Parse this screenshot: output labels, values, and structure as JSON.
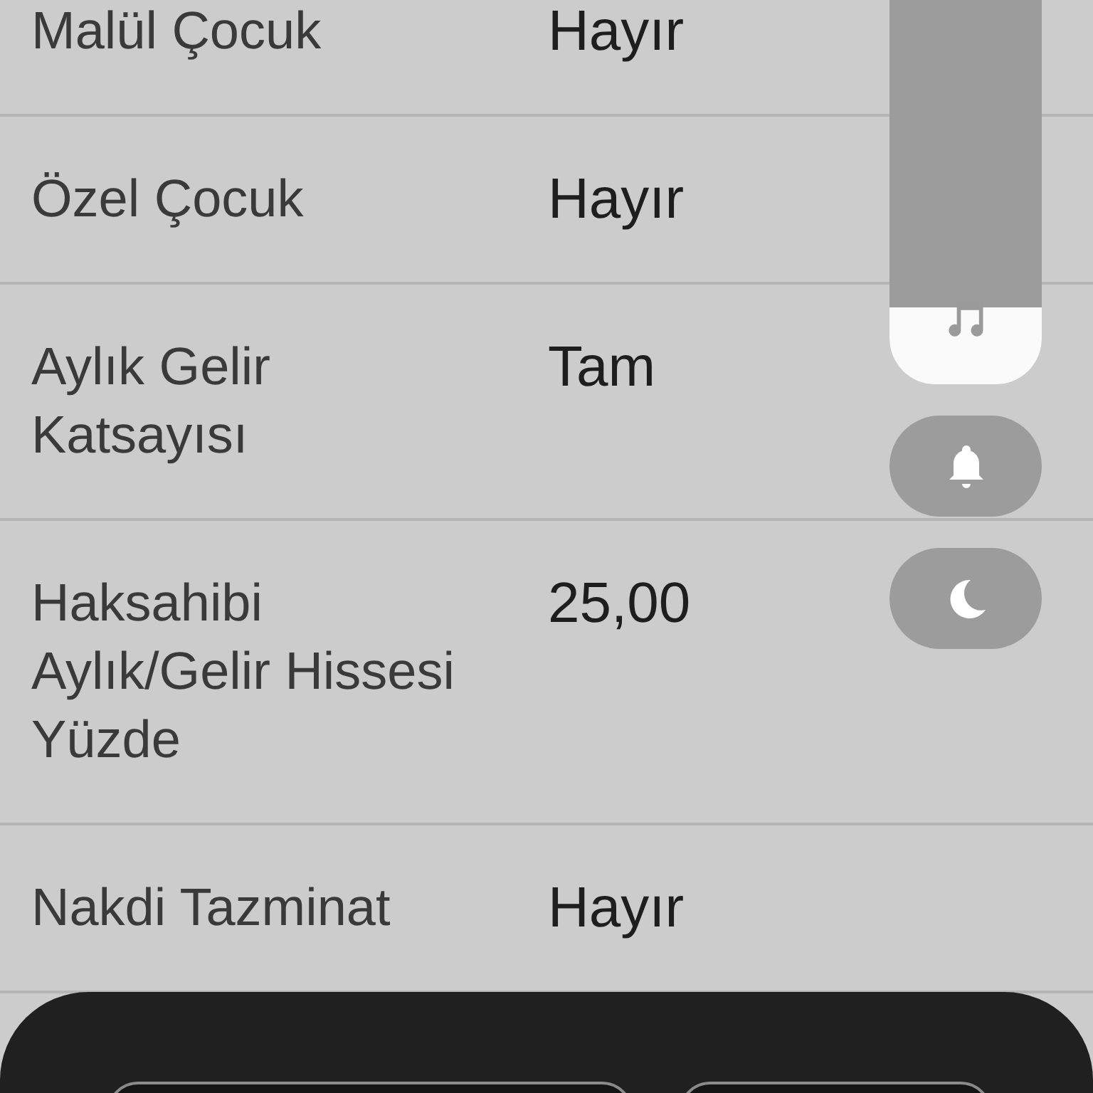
{
  "rows": [
    {
      "label": "Malül Çocuk",
      "value": "Hayır"
    },
    {
      "label": "Özel Çocuk",
      "value": "Hayır"
    },
    {
      "label": "Aylık Gelir Katsayısı",
      "value": "Tam"
    },
    {
      "label": "Haksahibi Aylık/Gelir Hissesi Yüzde",
      "value": "25,00"
    },
    {
      "label": "Nakdi Tazminat",
      "value": "Hayır"
    }
  ],
  "volume_panel": {
    "level": 0.2
  }
}
